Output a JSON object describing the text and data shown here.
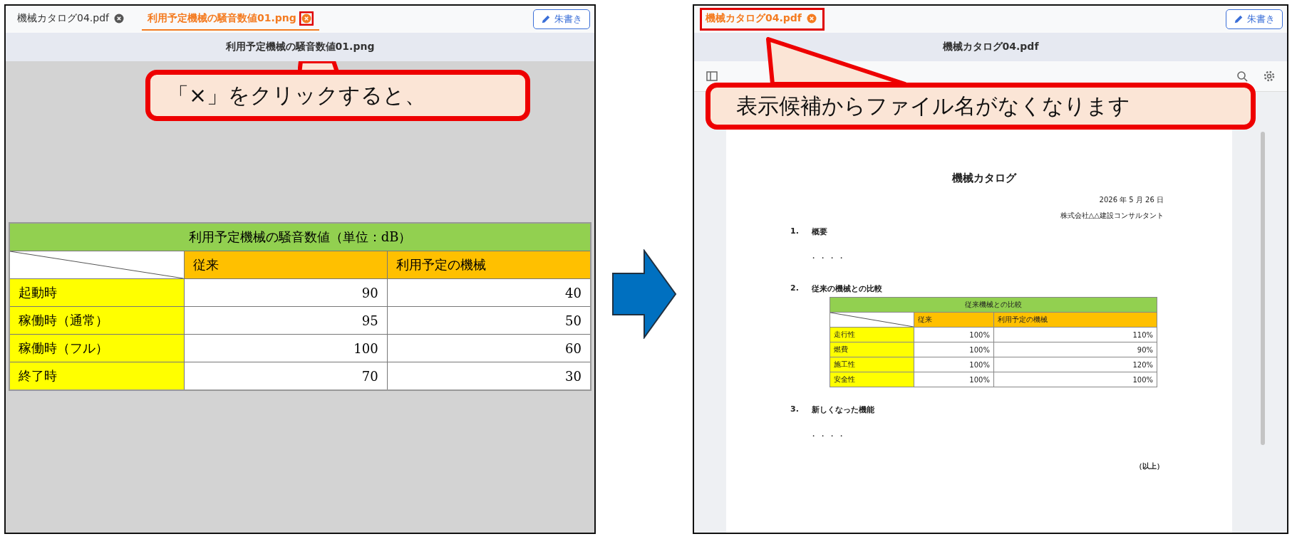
{
  "left_panel": {
    "tabs": [
      {
        "label": "機械カタログ04.pdf",
        "selected": false,
        "tab_highlighted": false,
        "close_highlighted": false
      },
      {
        "label": "利用予定機械の騒音数値01.png",
        "selected": true,
        "tab_highlighted": false,
        "close_highlighted": true
      }
    ],
    "annotate_button": "朱書き",
    "file_title": "利用予定機械の騒音数値01.png",
    "table": {
      "title": "利用予定機械の騒音数値（単位：dB）",
      "columns": [
        "従来",
        "利用予定の機械"
      ],
      "rows": [
        {
          "label": "起動時",
          "values": [
            "90",
            "40"
          ]
        },
        {
          "label": "稼働時（通常）",
          "values": [
            "95",
            "50"
          ]
        },
        {
          "label": "稼働時（フル）",
          "values": [
            "100",
            "60"
          ]
        },
        {
          "label": "終了時",
          "values": [
            "70",
            "30"
          ]
        }
      ]
    }
  },
  "callout_left": {
    "text": "「×」をクリックすると、"
  },
  "right_panel": {
    "tabs": [
      {
        "label": "機械カタログ04.pdf",
        "selected": true,
        "tab_highlighted": true,
        "close_highlighted": false
      }
    ],
    "annotate_button": "朱書き",
    "file_title": "機械カタログ04.pdf",
    "document": {
      "title": "機械カタログ",
      "date": "2026 年 5 月 26 日",
      "company": "株式会社△△建設コンサルタント",
      "sections": [
        {
          "number": "1.",
          "heading": "概要",
          "body": "・・・・"
        },
        {
          "number": "2.",
          "heading": "従来の機械との比較",
          "table": {
            "title": "従来機械との比較",
            "columns": [
              "従来",
              "利用予定の機械"
            ],
            "rows": [
              {
                "label": "走行性",
                "values": [
                  "100%",
                  "110%"
                ]
              },
              {
                "label": "燃費",
                "values": [
                  "100%",
                  "90%"
                ]
              },
              {
                "label": "施工性",
                "values": [
                  "100%",
                  "120%"
                ]
              },
              {
                "label": "安全性",
                "values": [
                  "100%",
                  "100%"
                ]
              }
            ]
          }
        },
        {
          "number": "3.",
          "heading": "新しくなった機能",
          "body": "・・・・"
        }
      ],
      "closing": "（以上）"
    }
  },
  "callout_right": {
    "text": "表示候補からファイル名がなくなります"
  }
}
